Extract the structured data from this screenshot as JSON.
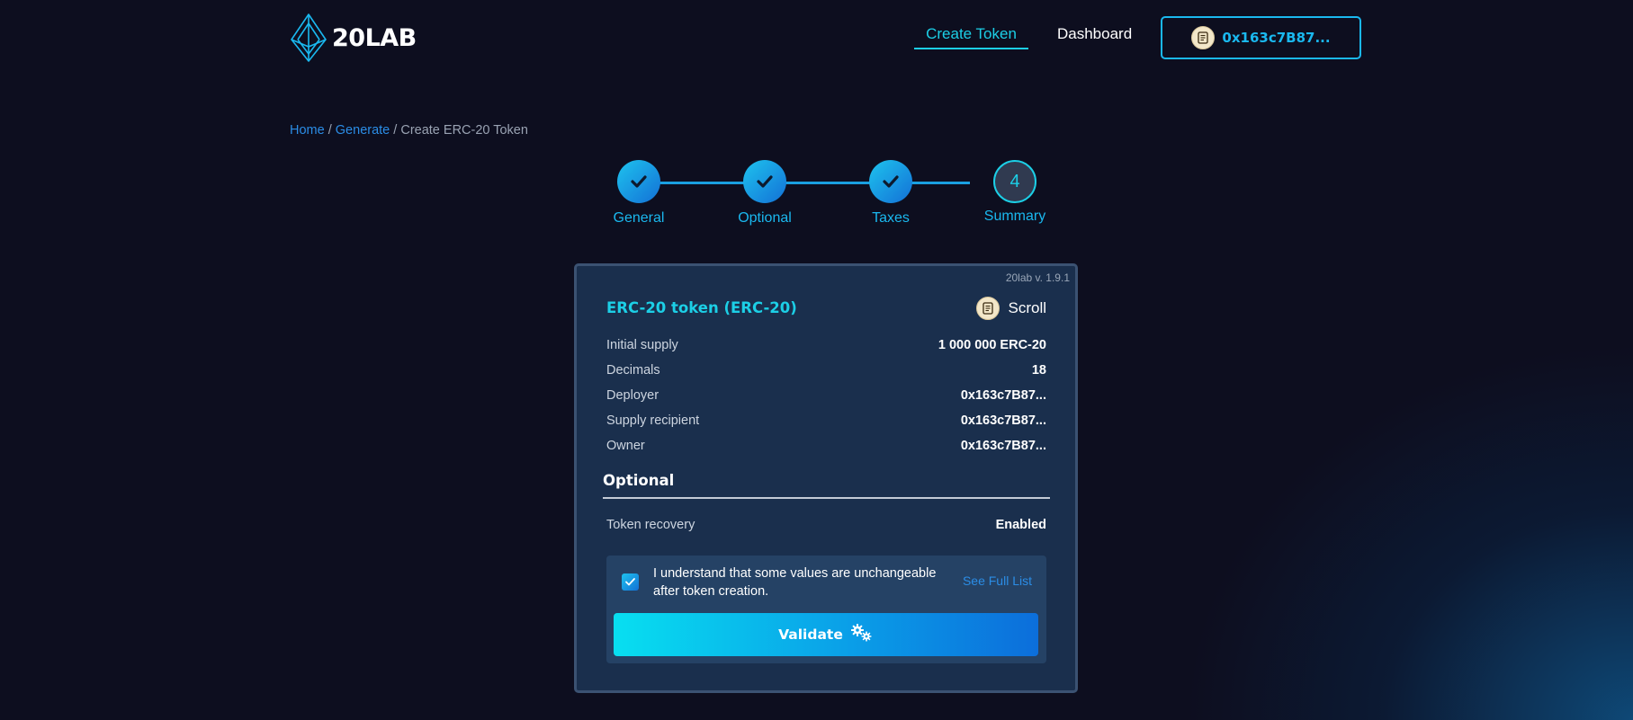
{
  "header": {
    "logo_text": "20LAB",
    "nav": {
      "create_token": "Create Token",
      "dashboard": "Dashboard"
    },
    "wallet_address": "0x163c7B87..."
  },
  "breadcrumb": {
    "home": "Home",
    "separator": "/",
    "generate": "Generate",
    "current": "Create ERC-20 Token"
  },
  "stepper": {
    "steps": [
      {
        "label": "General",
        "status": "complete"
      },
      {
        "label": "Optional",
        "status": "complete"
      },
      {
        "label": "Taxes",
        "status": "complete"
      },
      {
        "label": "Summary",
        "status": "current",
        "number": "4"
      }
    ]
  },
  "card": {
    "version": "20lab v. 1.9.1",
    "title": "ERC-20 token (ERC-20)",
    "network": "Scroll",
    "rows": [
      {
        "label": "Initial supply",
        "value": "1 000 000 ERC-20"
      },
      {
        "label": "Decimals",
        "value": "18"
      },
      {
        "label": "Deployer",
        "value": "0x163c7B87..."
      },
      {
        "label": "Supply recipient",
        "value": "0x163c7B87..."
      },
      {
        "label": "Owner",
        "value": "0x163c7B87..."
      }
    ],
    "optional_section": {
      "title": "Optional",
      "rows": [
        {
          "label": "Token recovery",
          "value": "Enabled"
        }
      ]
    },
    "confirm": {
      "checked": true,
      "text": "I understand that some values are unchangeable after token creation.",
      "link": "See Full List"
    },
    "validate_label": "Validate"
  },
  "colors": {
    "accent_cyan": "#1ccfe6",
    "accent_blue": "#1ab8ef",
    "link_blue": "#2b8de6",
    "page_bg": "#0d0e1f",
    "card_bg": "#1a2f4d"
  },
  "icons": {
    "logo": "ethereum-diamond-icon",
    "network": "scroll-icon",
    "step_complete": "checkmark-icon",
    "validate": "gears-icon"
  }
}
